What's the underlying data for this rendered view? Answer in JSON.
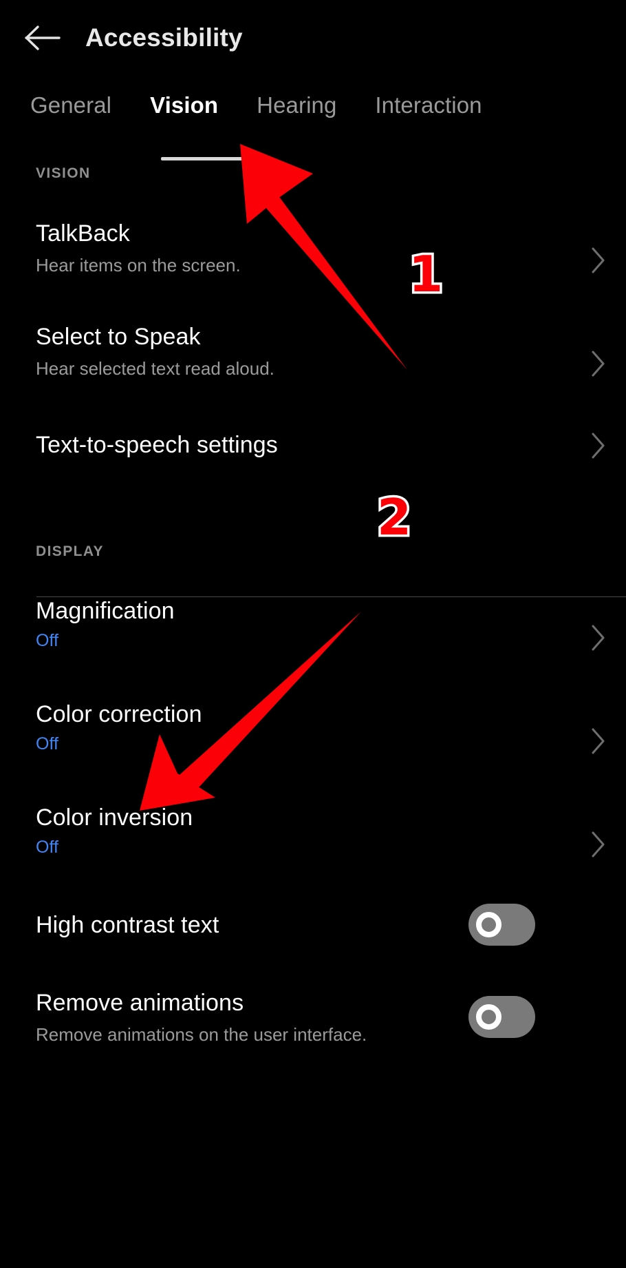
{
  "appbar": {
    "back_icon": "arrow-left-icon",
    "title": "Accessibility"
  },
  "tabs": [
    {
      "label": "General",
      "active": false
    },
    {
      "label": "Vision",
      "active": true
    },
    {
      "label": "Hearing",
      "active": false
    },
    {
      "label": "Interaction",
      "active": false
    }
  ],
  "sections": [
    {
      "header": "VISION",
      "rows": [
        {
          "title": "TalkBack",
          "sub": "Hear items on the screen.",
          "chevron": true
        },
        {
          "title": "Select to Speak",
          "sub": "Hear selected text read aloud.",
          "chevron": true
        },
        {
          "title": "Text-to-speech settings",
          "sub": "",
          "chevron": true
        }
      ]
    },
    {
      "header": "DISPLAY",
      "rows": [
        {
          "title": "Magnification",
          "value": "Off",
          "chevron": true
        },
        {
          "title": "Color correction",
          "value": "Off",
          "chevron": true
        },
        {
          "title": "Color inversion",
          "value": "Off",
          "chevron": true
        },
        {
          "title": "High contrast text",
          "sub": "",
          "toggle": "off"
        },
        {
          "title": "Remove animations",
          "sub": "Remove animations on the user interface.",
          "toggle": "off"
        }
      ]
    }
  ],
  "annotations": [
    {
      "label": "1"
    },
    {
      "label": "2"
    }
  ],
  "colors": {
    "background": "#000000",
    "primary_text": "#fdfdfd",
    "secondary_text": "#9b9b9b",
    "section_header": "#8f8f8f",
    "value_blue": "#4285f4",
    "annotation_red": "#fb0007",
    "toggle_track": "#7a7a7a",
    "tab_indicator": "#d8d8d8"
  }
}
